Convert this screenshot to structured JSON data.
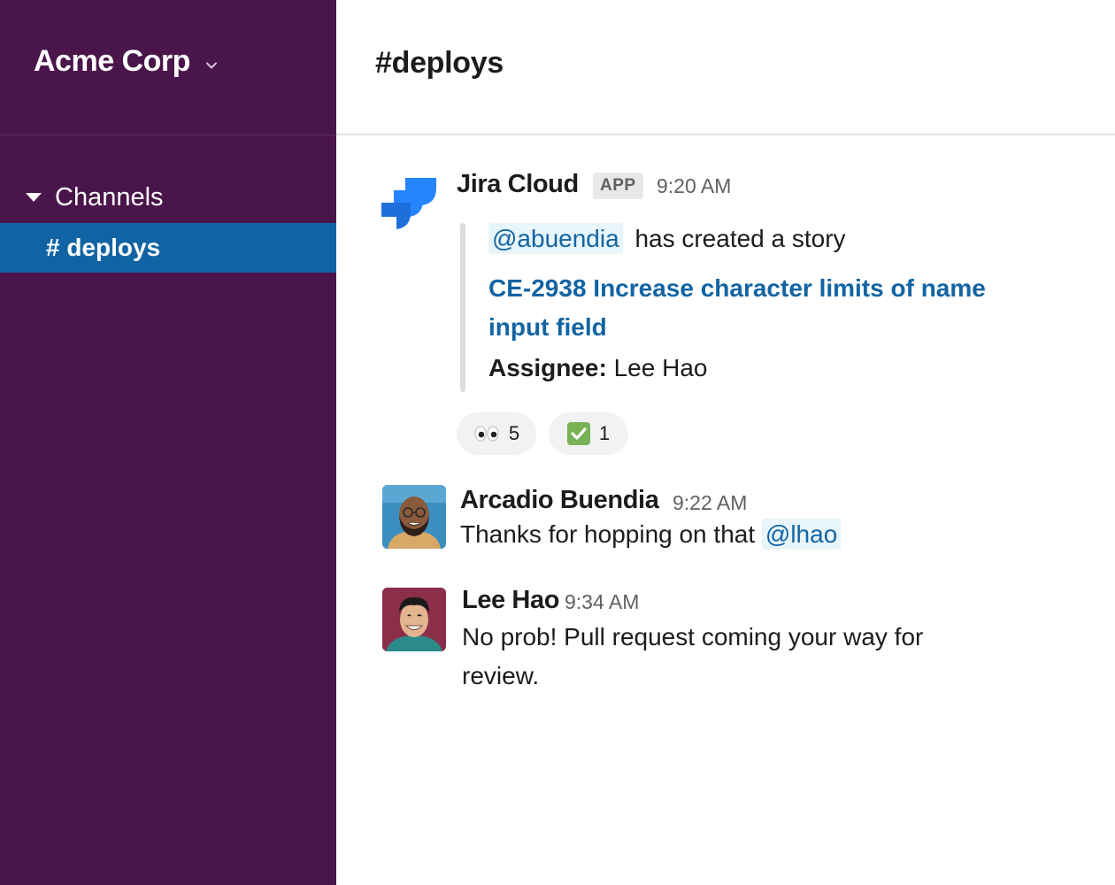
{
  "workspace": {
    "name": "Acme Corp"
  },
  "sidebar": {
    "section_label": "Channels",
    "channels": [
      {
        "label": "# deploys",
        "active": true
      }
    ]
  },
  "channel": {
    "title": "#deploys"
  },
  "messages": [
    {
      "sender": "Jira Cloud",
      "badge": "APP",
      "time": "9:20 AM",
      "mention": "@abuendia",
      "text": "has created a story",
      "link_line1": "CE-2938 Increase character limits of name",
      "link_line2": "input field",
      "assignee_label": "Assignee:",
      "assignee_value": "Lee Hao",
      "reactions": [
        {
          "emoji": "eyes",
          "count": "5"
        },
        {
          "emoji": "check-mark",
          "count": "1"
        }
      ]
    },
    {
      "sender": "Arcadio Buendia",
      "time": "9:22 AM",
      "text": "Thanks for hopping on that",
      "mention": "@lhao"
    },
    {
      "sender": "Lee Hao",
      "time": "9:34 AM",
      "text_line1": "No prob! Pull request coming your way for",
      "text_line2": "review."
    }
  ],
  "colors": {
    "sidebar_bg": "#4a154b",
    "active_channel": "#1164a3",
    "link": "#1264a3",
    "mention_bg": "#e8f5fa",
    "jira_blue": "#2684ff"
  }
}
